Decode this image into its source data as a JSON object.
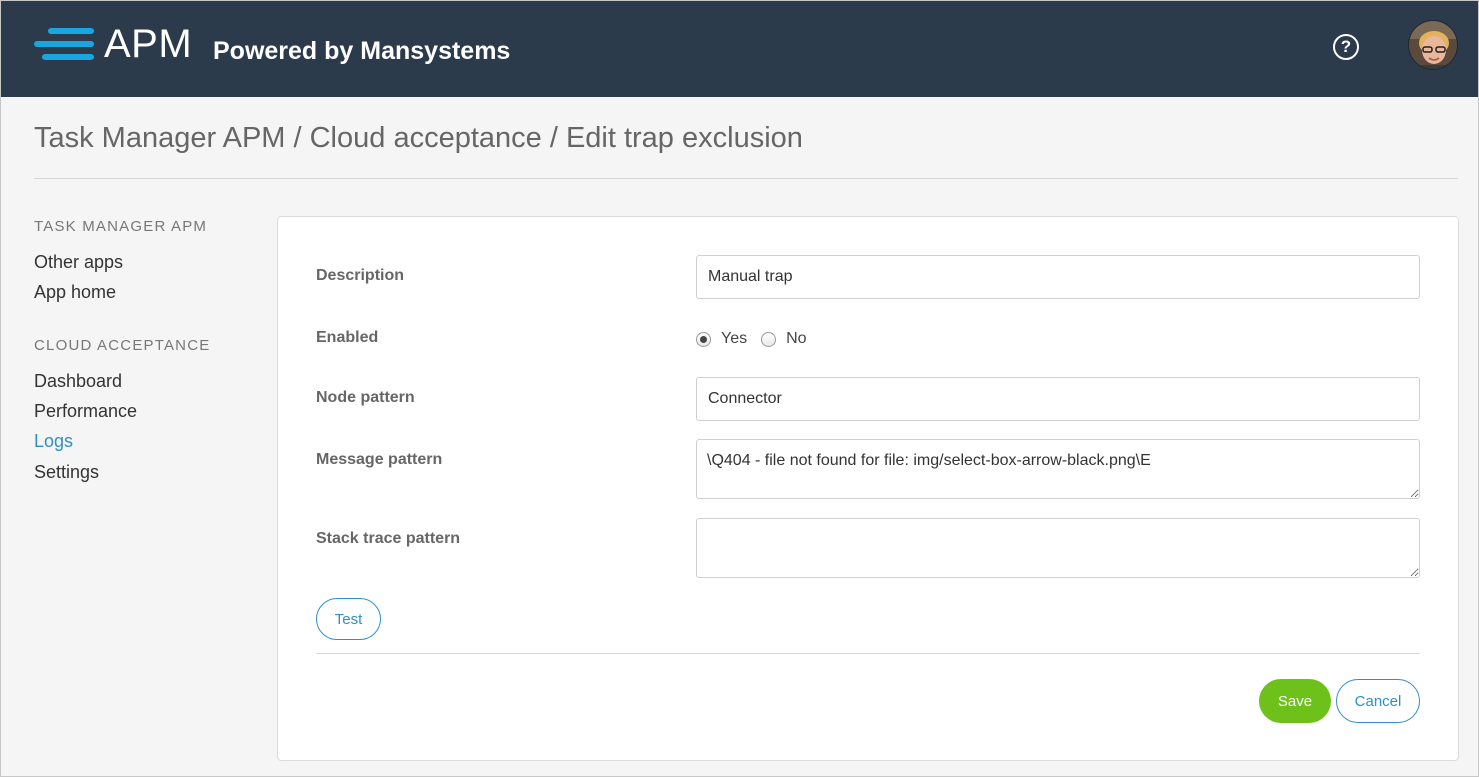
{
  "header": {
    "logo_text": "APM",
    "powered_by": "Powered by Mansystems",
    "help_icon": "question-circle-icon",
    "help_glyph": "?",
    "avatar_icon": "user-avatar"
  },
  "breadcrumb": {
    "title": "Task Manager APM / Cloud acceptance / Edit trap exclusion"
  },
  "sidebar": {
    "sections": [
      {
        "heading": "TASK MANAGER APM",
        "items": [
          "Other apps",
          "App home"
        ]
      },
      {
        "heading": "CLOUD ACCEPTANCE",
        "items": [
          "Dashboard",
          "Performance",
          "Logs",
          "Settings"
        ]
      }
    ],
    "active_item": "Logs"
  },
  "form": {
    "description_label": "Description",
    "description_value": "Manual trap",
    "enabled_label": "Enabled",
    "enabled_options": [
      "Yes",
      "No"
    ],
    "enabled_selected": "Yes",
    "node_pattern_label": "Node pattern",
    "node_pattern_value": "Connector",
    "message_pattern_label": "Message pattern",
    "message_pattern_value": "\\Q404 - file not found for file: img/select-box-arrow-black.png\\E",
    "stack_trace_label": "Stack trace pattern",
    "stack_trace_value": "",
    "test_label": "Test",
    "save_label": "Save",
    "cancel_label": "Cancel"
  },
  "colors": {
    "header_bg": "#2b3b4c",
    "accent": "#2f8fc6",
    "save": "#6ec01b"
  }
}
